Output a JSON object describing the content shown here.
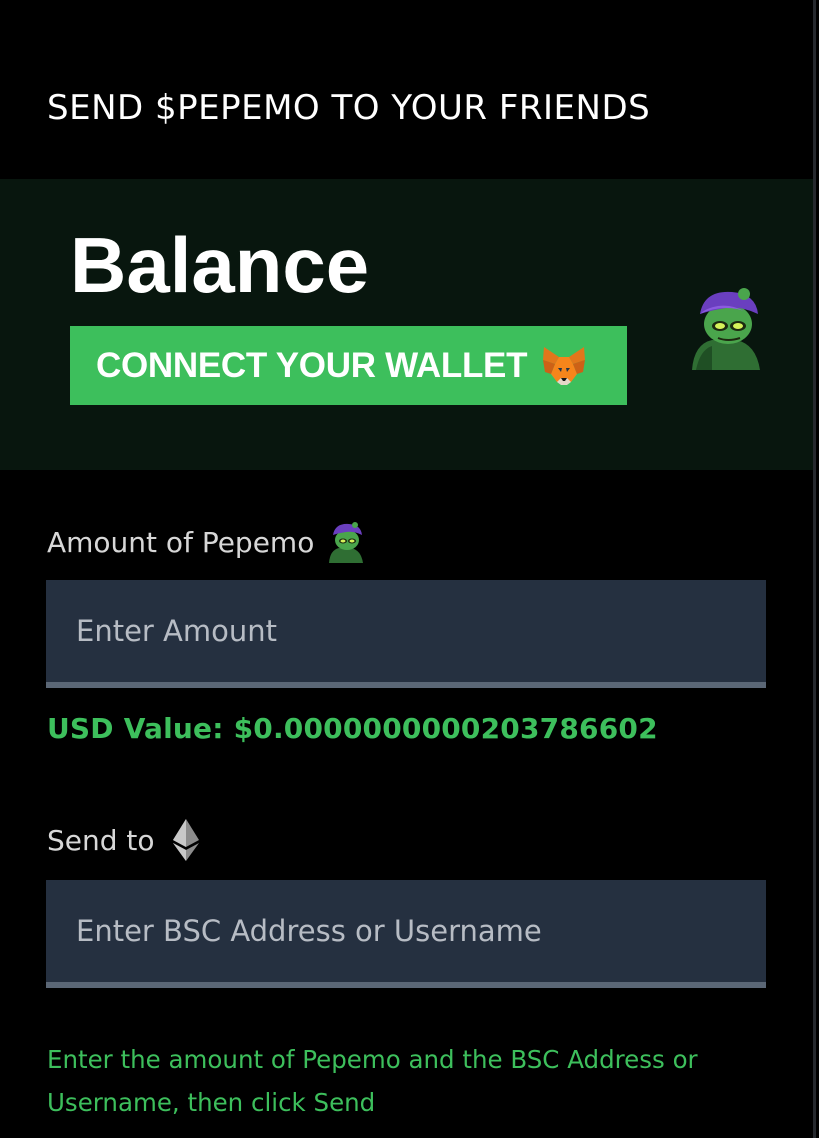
{
  "header": {
    "title": "SEND $PEPEMO TO YOUR FRIENDS"
  },
  "balance": {
    "label": "Balance",
    "connect_button_label": "CONNECT YOUR WALLET",
    "connect_button_icon": "metamask-fox-icon",
    "avatar_icon": "pepemo-avatar-icon"
  },
  "amount": {
    "label": "Amount of Pepemo",
    "icon": "pepemo-avatar-icon",
    "placeholder": "Enter Amount",
    "value": ""
  },
  "usd": {
    "text": "USD Value: $0.0000000000203786602"
  },
  "send_to": {
    "label": "Send to",
    "icon": "ethereum-icon",
    "placeholder": "Enter BSC Address or Username",
    "value": ""
  },
  "hint": {
    "text": "Enter the amount of Pepemo and the BSC Address or Username, then click Send"
  },
  "colors": {
    "accent": "#3dbf5c",
    "background": "#000000",
    "balance_panel": "#08160e",
    "input_background": "#253040",
    "input_underline": "#5b6776"
  }
}
